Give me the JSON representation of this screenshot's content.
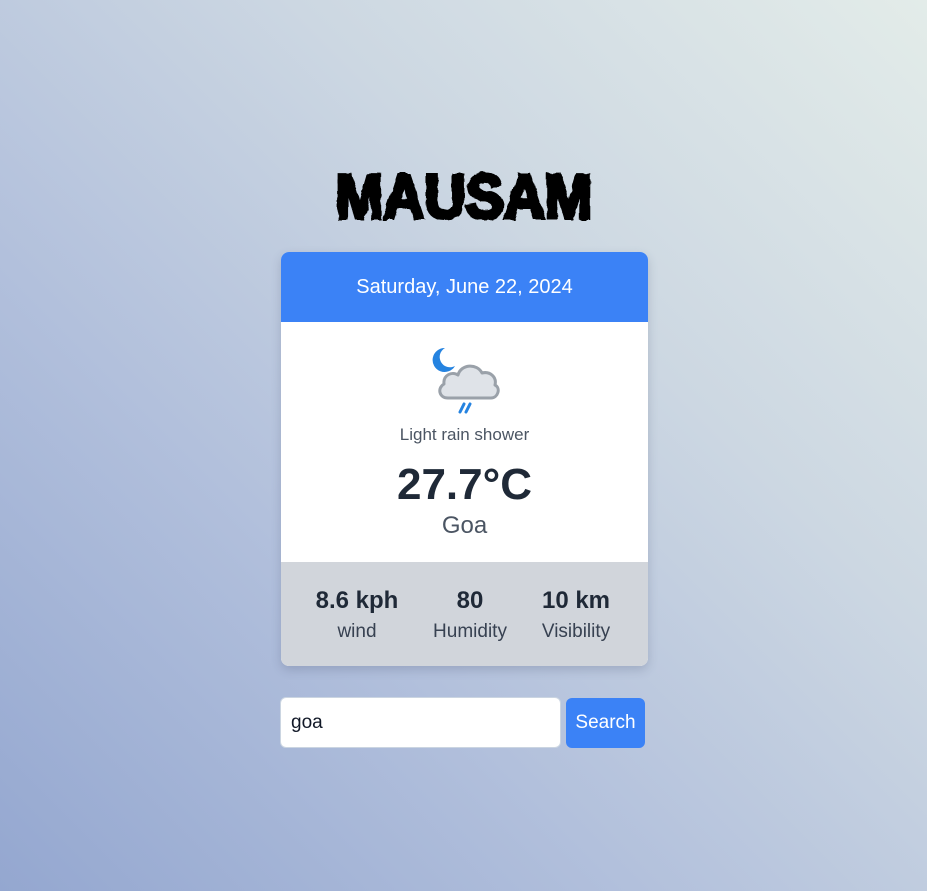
{
  "brand": {
    "title": "MAUSAM"
  },
  "weather": {
    "date": "Saturday, June 22, 2024",
    "icon": "night-cloud-rain-icon",
    "condition": "Light rain shower",
    "temperature": "27.7°C",
    "city": "Goa"
  },
  "stats": [
    {
      "value": "8.6 kph",
      "label": "wind"
    },
    {
      "value": "80",
      "label": "Humidity"
    },
    {
      "value": "10 km",
      "label": "Visibility"
    }
  ],
  "search": {
    "value": "goa",
    "button_label": "Search"
  },
  "colors": {
    "accent": "#3b82f6",
    "footer": "#d1d5db",
    "text_dark": "#1f2937"
  }
}
